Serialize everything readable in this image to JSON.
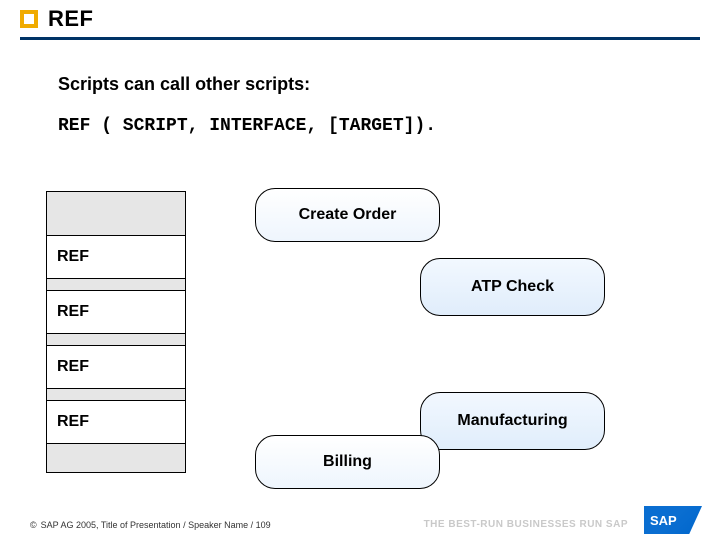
{
  "title": "REF",
  "subtitle": "Scripts can call other scripts:",
  "syntax": "REF ( SCRIPT, INTERFACE, [TARGET]).",
  "refs": [
    "REF",
    "REF",
    "REF",
    "REF"
  ],
  "bubbles": {
    "create_order": "Create Order",
    "atp_check": "ATP Check",
    "manufacturing": "Manufacturing",
    "billing": "Billing"
  },
  "footer": {
    "copyright": "©",
    "text": "SAP AG 2005, Title of Presentation / Speaker Name / 109"
  },
  "tagline": "THE BEST-RUN BUSINESSES RUN SAP",
  "logo": "SAP"
}
